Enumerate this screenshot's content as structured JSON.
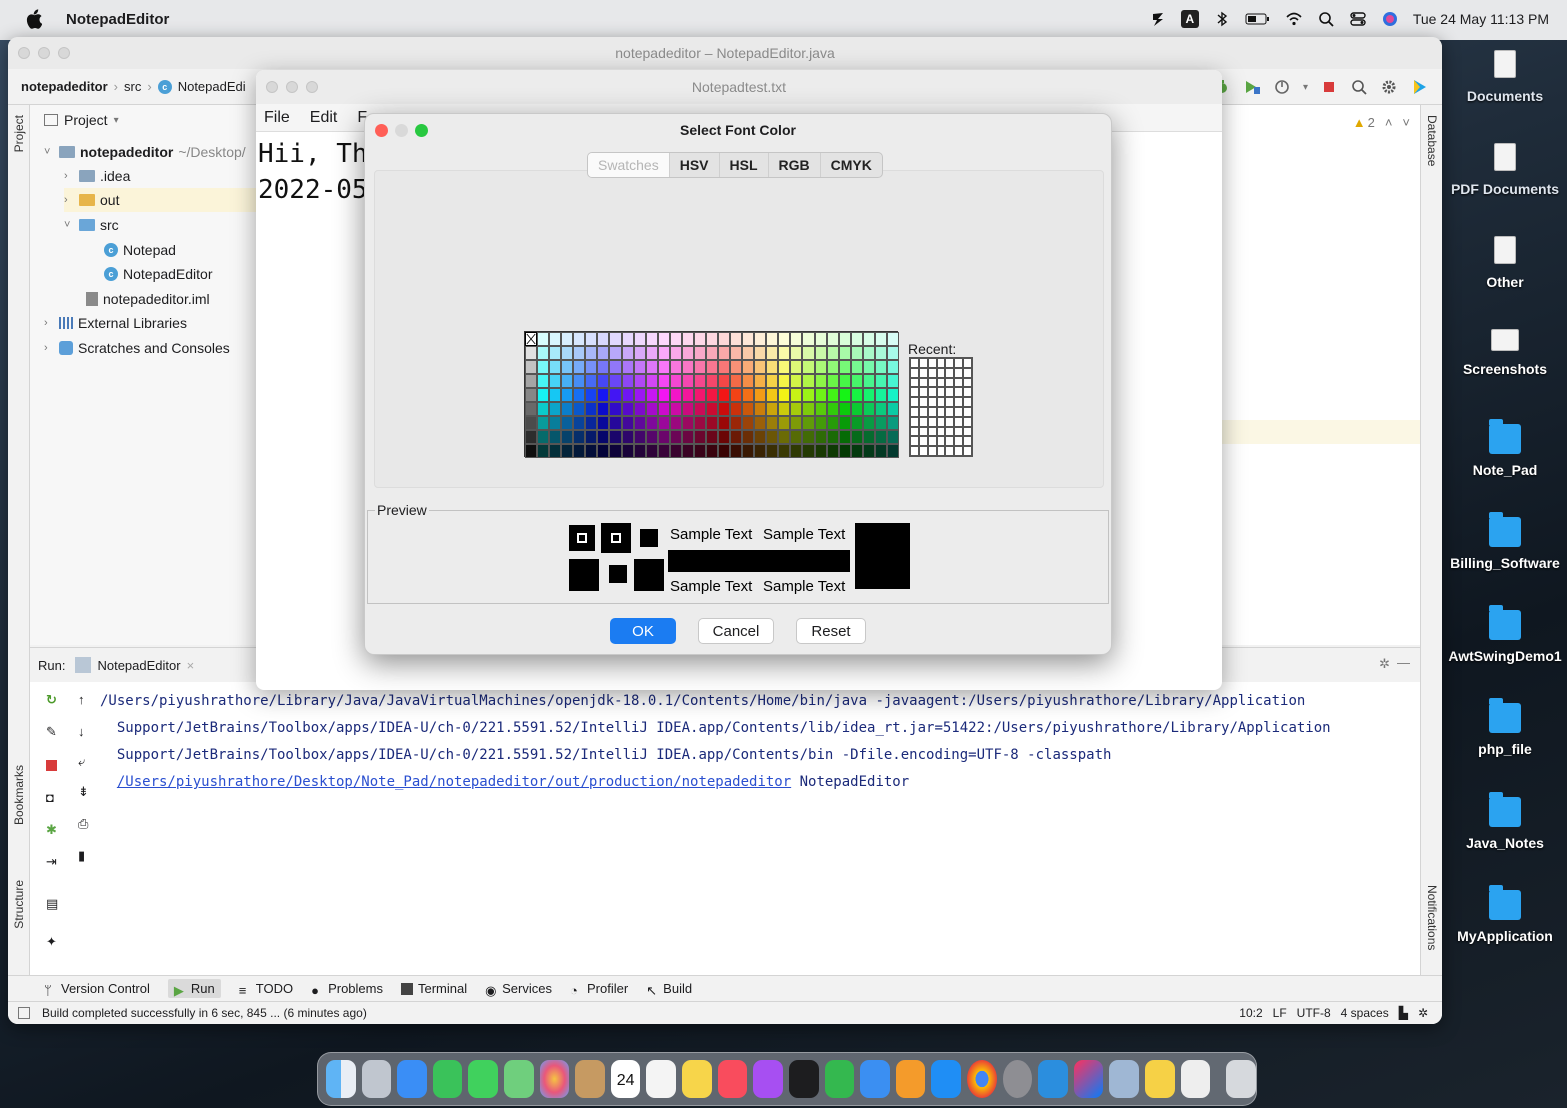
{
  "menubar": {
    "app_name": "NotepadEditor",
    "clock": "Tue 24 May  11:13 PM",
    "status_icons": [
      "bolt-icon",
      "keyboard-a-icon",
      "bluetooth-icon",
      "battery-icon",
      "wifi-icon",
      "spotlight-icon",
      "control-center-icon",
      "siri-icon"
    ]
  },
  "desktop": {
    "items": [
      {
        "label": "Documents",
        "icon": "document-icon"
      },
      {
        "label": "PDF Documents",
        "icon": "document-icon"
      },
      {
        "label": "Other",
        "icon": "document-icon"
      },
      {
        "label": "Screenshots",
        "icon": "document-icon"
      },
      {
        "label": "Note_Pad",
        "icon": "folder-icon"
      },
      {
        "label": "Billing_Software",
        "icon": "folder-icon"
      },
      {
        "label": "AwtSwingDemo1",
        "icon": "folder-icon"
      },
      {
        "label": "php_file",
        "icon": "folder-icon"
      },
      {
        "label": "Java_Notes",
        "icon": "folder-icon"
      },
      {
        "label": "MyApplication",
        "icon": "folder-icon"
      }
    ]
  },
  "ide": {
    "title": "notepadeditor – NotepadEditor.java",
    "breadcrumb": [
      "notepadeditor",
      "src",
      "NotepadEdi"
    ],
    "project_header": "Project",
    "tree": [
      {
        "label": "notepadeditor",
        "suffix": "~/Desktop/"
      },
      {
        "label": ".idea"
      },
      {
        "label": "out"
      },
      {
        "label": "src"
      },
      {
        "label": "Notepad"
      },
      {
        "label": "NotepadEditor"
      },
      {
        "label": "notepadeditor.iml"
      },
      {
        "label": "External Libraries"
      },
      {
        "label": "Scratches and Consoles"
      }
    ],
    "left_strip": {
      "project": "Project",
      "bookmarks": "Bookmarks",
      "structure": "Structure"
    },
    "right_strip": {
      "database": "Database",
      "notifications": "Notifications"
    },
    "warnings": "2",
    "run": {
      "label": "Run:",
      "tab": "NotepadEditor",
      "console_lines": [
        "/Users/piyushrathore/Library/Java/JavaVirtualMachines/openjdk-18.0.1/Contents/Home/bin/java -javaagent:/Users/piyushrathore/Library/Application",
        "  Support/JetBrains/Toolbox/apps/IDEA-U/ch-0/221.5591.52/IntelliJ IDEA.app/Contents/lib/idea_rt.jar=51422:/Users/piyushrathore/Library/Application",
        "  Support/JetBrains/Toolbox/apps/IDEA-U/ch-0/221.5591.52/IntelliJ IDEA.app/Contents/bin -Dfile.encoding=UTF-8 -classpath"
      ],
      "console_link": "/Users/piyushrathore/Desktop/Note_Pad/notepadeditor/out/production/notepadeditor",
      "console_main": "NotepadEditor"
    },
    "bottom_tabs": [
      "Version Control",
      "Run",
      "TODO",
      "Problems",
      "Terminal",
      "Services",
      "Profiler",
      "Build"
    ],
    "status": {
      "message": "Build completed successfully in 6 sec, 845 ... (6 minutes ago)",
      "position": "10:2",
      "line_sep": "LF",
      "encoding": "UTF-8",
      "indent": "4 spaces"
    }
  },
  "notepad": {
    "title": "Notepadtest.txt",
    "menus": [
      "File",
      "Edit",
      "F"
    ],
    "text_lines": [
      "Hii, Th",
      "2022-05"
    ]
  },
  "dialog": {
    "title": "Select Font Color",
    "tabs": [
      "Swatches",
      "HSV",
      "HSL",
      "RGB",
      "CMYK"
    ],
    "selected_tab": "Swatches",
    "recent_label": "Recent:",
    "preview_label": "Preview",
    "sample_text": "Sample Text",
    "buttons": {
      "ok": "OK",
      "cancel": "Cancel",
      "reset": "Reset"
    },
    "colors": {
      "ok_blue": "#1b7cf2",
      "close_red": "#ff5f57",
      "minimize_gray": "#d9d9d9",
      "zoom_green": "#28c840"
    }
  },
  "dock": {
    "apps": [
      "finder-icon",
      "launchpad-icon",
      "mail-icon",
      "facetime-icon",
      "messages-icon",
      "maps-icon",
      "photos-icon",
      "contacts-icon",
      "calendar-icon",
      "reminders-icon",
      "notes-icon",
      "music-icon",
      "podcasts-icon",
      "tv-icon",
      "numbers-icon",
      "keynote-icon",
      "pages-icon",
      "appstore-icon",
      "chrome-icon",
      "settings-icon",
      "vscode-icon",
      "intellij-icon",
      "preview-icon",
      "java-icon",
      "nuke-icon",
      "trash-icon"
    ],
    "calendar_day": "24"
  }
}
